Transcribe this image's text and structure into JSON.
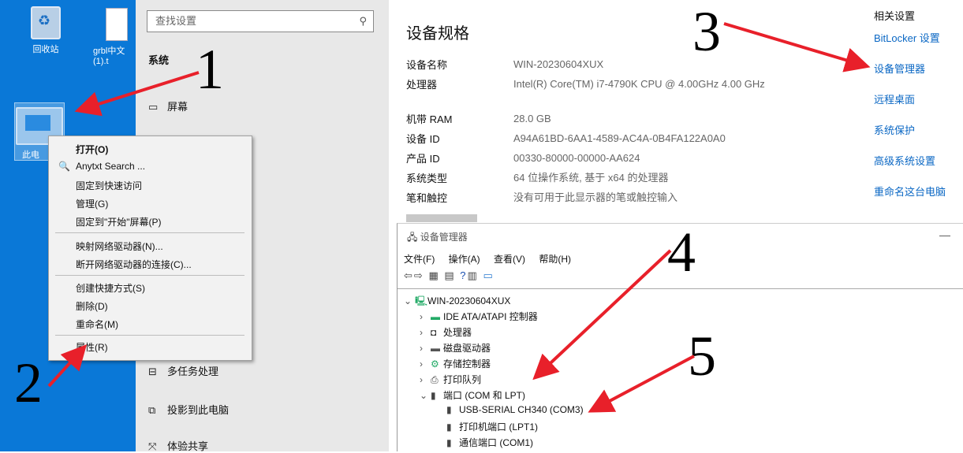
{
  "desktop": {
    "icons": [
      {
        "label": "回收站",
        "icon": "recycle-bin-icon"
      },
      {
        "label": "grbl中文\n(1).t",
        "icon": "text-file-icon"
      },
      {
        "label": "此电",
        "icon": "computer-icon"
      }
    ]
  },
  "context_menu": {
    "items": [
      {
        "label": "打开(O)"
      },
      {
        "label": "Anytxt Search ...",
        "icon": "search-icon"
      },
      {
        "label": "固定到快速访问"
      },
      {
        "label": "管理(G)"
      },
      {
        "label": "固定到\"开始\"屏幕(P)"
      },
      {
        "label": "映射网络驱动器(N)..."
      },
      {
        "label": "断开网络驱动器的连接(C)..."
      },
      {
        "label": "创建快捷方式(S)"
      },
      {
        "label": "删除(D)"
      },
      {
        "label": "重命名(M)"
      },
      {
        "label": "属性(R)"
      }
    ]
  },
  "settings": {
    "search_placeholder": "查找设置",
    "section": "系统",
    "nav": [
      {
        "label": "屏幕",
        "icon": "monitor-icon"
      },
      {
        "label": "多任务处理",
        "icon": "multitask-icon"
      },
      {
        "label": "投影到此电脑",
        "icon": "project-icon"
      },
      {
        "label": "体验共享",
        "icon": "share-icon"
      }
    ],
    "spec_title": "设备规格",
    "specs": [
      {
        "key": "设备名称",
        "value": "WIN-20230604XUX"
      },
      {
        "key": "处理器",
        "value": "Intel(R) Core(TM) i7-4790K CPU @ 4.00GHz   4.00 GHz"
      },
      {
        "key": "机带 RAM",
        "value": "28.0 GB"
      },
      {
        "key": "设备 ID",
        "value": "A94A61BD-6AA1-4589-AC4A-0B4FA122A0A0"
      },
      {
        "key": "产品 ID",
        "value": "00330-80000-00000-AA624"
      },
      {
        "key": "系统类型",
        "value": "64 位操作系统, 基于 x64 的处理器"
      },
      {
        "key": "笔和触控",
        "value": "没有可用于此显示器的笔或触控输入"
      }
    ],
    "related_heading": "相关设置",
    "related_links": [
      "BitLocker 设置",
      "设备管理器",
      "远程桌面",
      "系统保护",
      "高级系统设置",
      "重命名这台电脑"
    ]
  },
  "device_manager": {
    "title": "设备管理器",
    "minimize": "—",
    "menus": [
      "文件(F)",
      "操作(A)",
      "查看(V)",
      "帮助(H)"
    ],
    "root": "WIN-20230604XUX",
    "nodes": [
      {
        "label": "IDE ATA/ATAPI 控制器",
        "expanded": false
      },
      {
        "label": "处理器",
        "expanded": false
      },
      {
        "label": "磁盘驱动器",
        "expanded": false
      },
      {
        "label": "存储控制器",
        "expanded": false
      },
      {
        "label": "打印队列",
        "expanded": false
      },
      {
        "label": "端口 (COM 和 LPT)",
        "expanded": true
      }
    ],
    "ports": [
      "USB-SERIAL CH340 (COM3)",
      "打印机端口 (LPT1)",
      "通信端口 (COM1)"
    ]
  },
  "annotations": [
    "1",
    "2",
    "3",
    "4",
    "5"
  ],
  "colors": {
    "arrow": "#e8202a",
    "link": "#0a67c4",
    "desktop": "#0a78d7"
  }
}
